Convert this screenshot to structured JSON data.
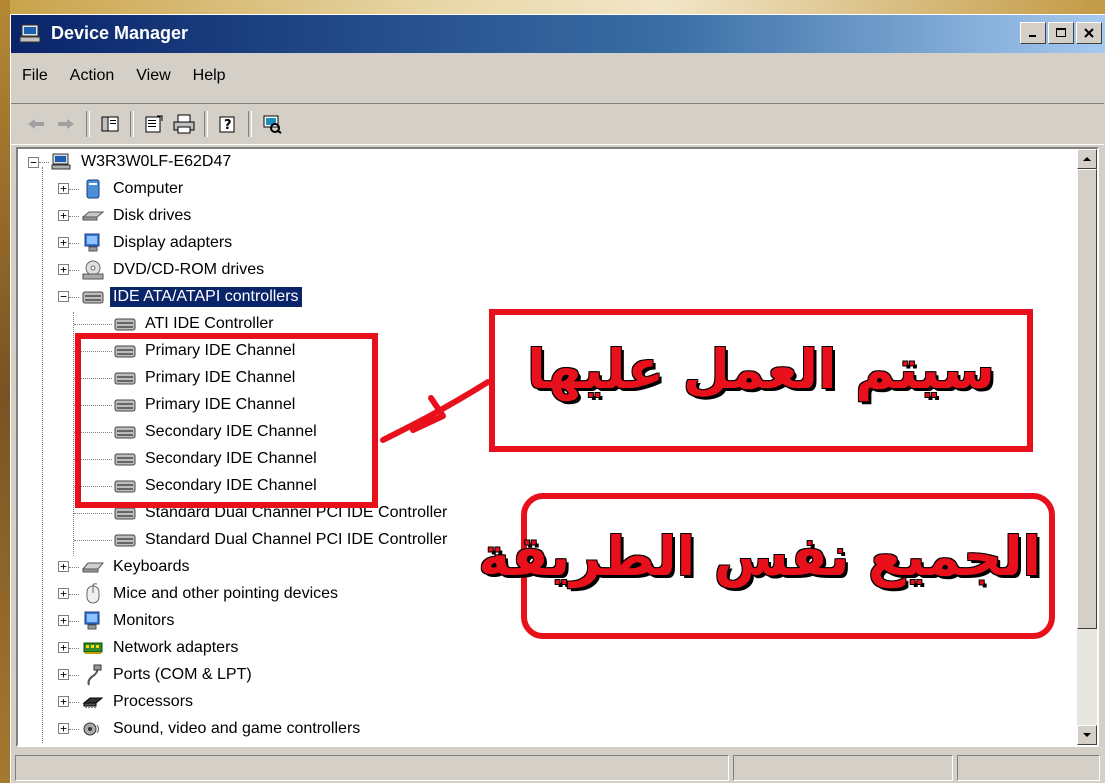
{
  "window": {
    "title": "Device Manager"
  },
  "menu": [
    "File",
    "Action",
    "View",
    "Help"
  ],
  "tree": {
    "root": "W3R3W0LF-E62D47",
    "categories": [
      "Computer",
      "Disk drives",
      "Display adapters",
      "DVD/CD-ROM drives",
      "IDE ATA/ATAPI controllers"
    ],
    "ide_children": [
      "ATI IDE Controller",
      "Primary IDE Channel",
      "Primary IDE Channel",
      "Primary IDE Channel",
      "Secondary IDE Channel",
      "Secondary IDE Channel",
      "Secondary IDE Channel",
      "Standard Dual Channel PCI IDE Controller",
      "Standard Dual Channel PCI IDE Controller"
    ],
    "categories_after": [
      "Keyboards",
      "Mice and other pointing devices",
      "Monitors",
      "Network adapters",
      "Ports (COM & LPT)",
      "Processors",
      "Sound, video and game controllers"
    ],
    "selected": "IDE ATA/ATAPI controllers"
  },
  "annotations": {
    "top_text": "سيتم العمل عليها",
    "bottom_text": "الجميع نفس الطريقة",
    "accent_color": "#e8101a"
  },
  "icons": [
    "computer-icon",
    "disk-drive-icon",
    "display-adapter-icon",
    "dvd-drive-icon",
    "ide-controller-icon",
    "keyboard-icon",
    "mouse-icon",
    "monitor-icon",
    "network-adapter-icon",
    "port-icon",
    "processor-icon",
    "sound-icon"
  ]
}
